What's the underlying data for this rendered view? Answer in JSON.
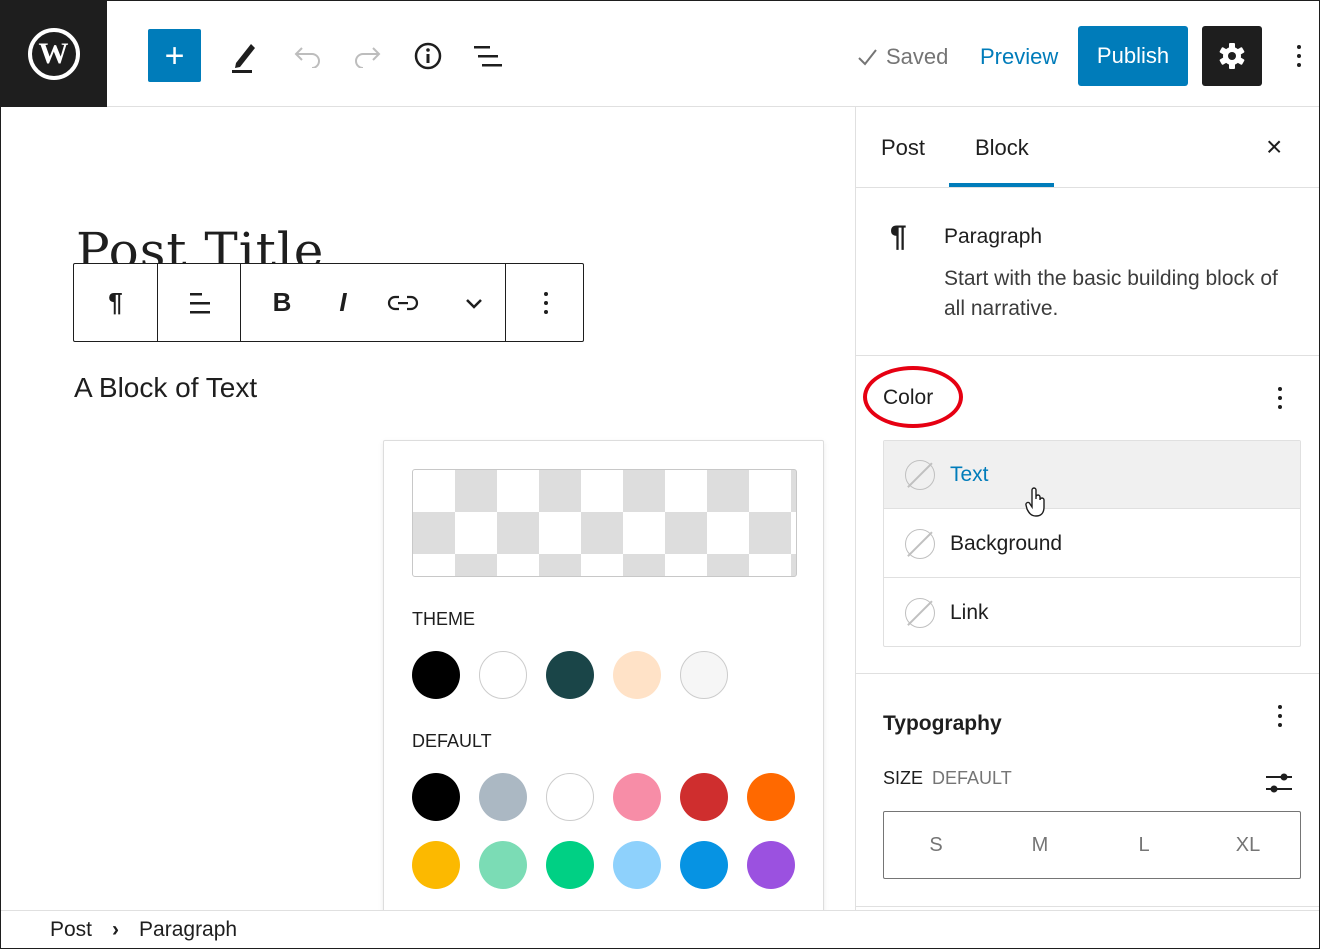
{
  "topbar": {
    "logo_letter": "W",
    "add_label": "+",
    "saved_label": "Saved",
    "preview_label": "Preview",
    "publish_label": "Publish",
    "icons": [
      "wordpress-logo",
      "plus-icon",
      "pen-tool-icon",
      "undo-icon",
      "redo-icon",
      "info-icon",
      "list-view-icon",
      "checkmark-icon",
      "gear-icon",
      "more-vertical-icon"
    ]
  },
  "editor": {
    "post_title": "Post Title",
    "block_text": "A Block of Text",
    "toolbar": {
      "paragraph_icon": "¶",
      "bold_label": "B",
      "italic_label": "I",
      "icons": [
        "paragraph-icon",
        "align-left-icon",
        "bold-icon",
        "italic-icon",
        "link-icon",
        "chevron-down-icon",
        "more-vertical-icon"
      ]
    }
  },
  "color_popover": {
    "theme_label": "THEME",
    "default_label": "DEFAULT",
    "theme_colors": [
      "#000000",
      "#ffffff",
      "#1a4548",
      "#ffe2c7",
      "#f6f6f6"
    ],
    "default_colors": [
      "#000000",
      "#abb8c3",
      "#ffffff",
      "#f78da7",
      "#cf2e2e",
      "#ff6900",
      "#fcb900",
      "#7bdcb5",
      "#00d084",
      "#8ed1fc",
      "#0693e3",
      "#9b51e0"
    ]
  },
  "sidebar": {
    "tabs": {
      "post": "Post",
      "block": "Block"
    },
    "close_label": "×",
    "block_card": {
      "icon": "¶",
      "name": "Paragraph",
      "description": "Start with the basic building block of all narrative."
    },
    "color_panel": {
      "title": "Color",
      "items": [
        {
          "label": "Text"
        },
        {
          "label": "Background"
        },
        {
          "label": "Link"
        }
      ]
    },
    "typography_panel": {
      "title": "Typography",
      "size_label": "SIZE",
      "size_value": "DEFAULT",
      "sizes": [
        "S",
        "M",
        "L",
        "XL"
      ]
    }
  },
  "footer": {
    "breadcrumb": [
      "Post",
      "Paragraph"
    ],
    "separator": "›"
  },
  "colors": {
    "accent": "#007cba",
    "dark": "#1e1e1e",
    "annotation_red": "#e60012"
  }
}
